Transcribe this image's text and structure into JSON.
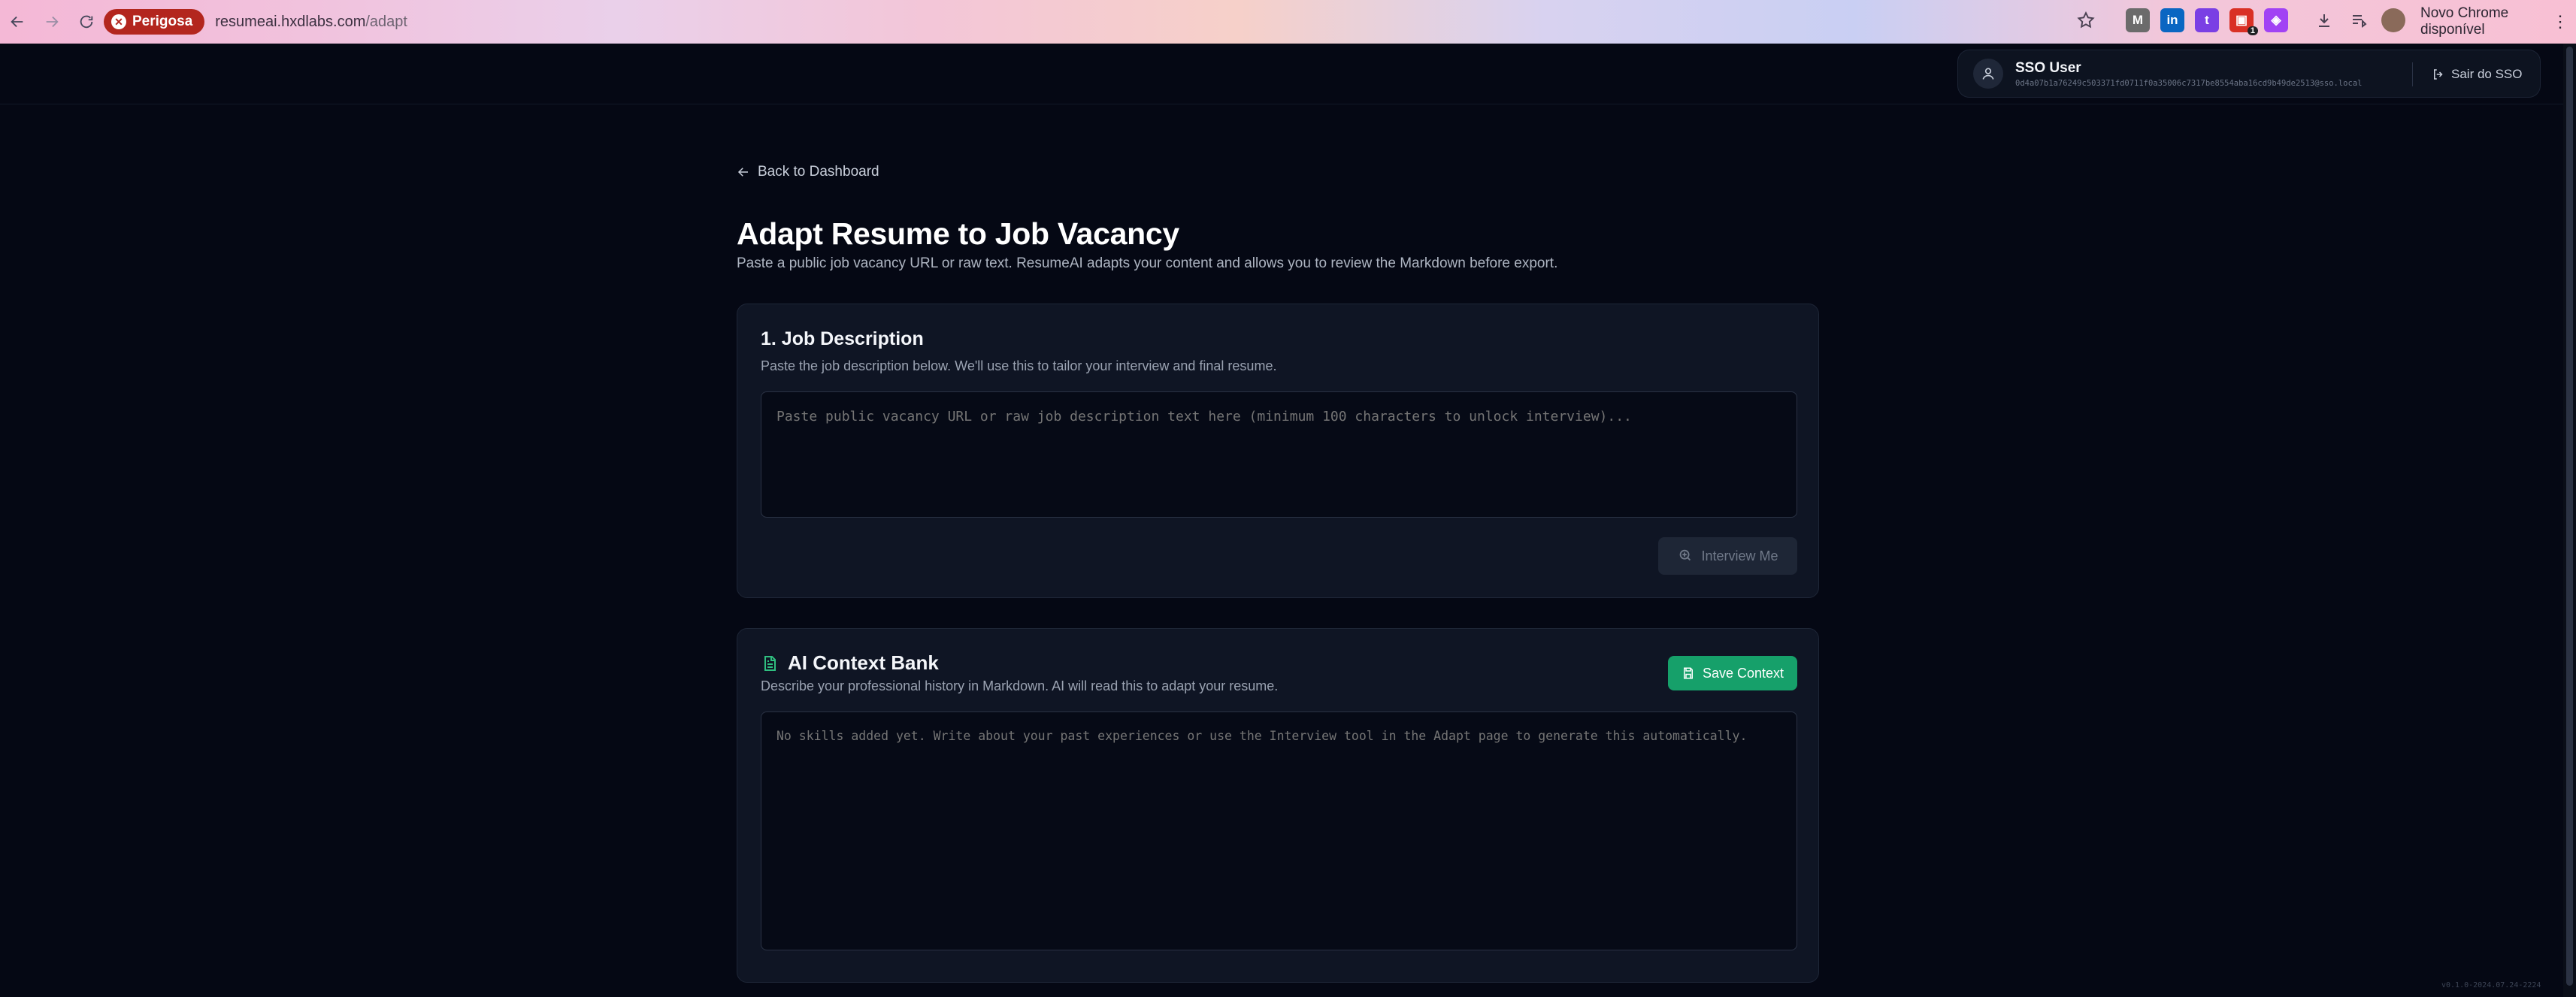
{
  "browser": {
    "security_label": "Perigosa",
    "url_host": "resumeai.hxdlabs.com",
    "url_path": "/adapt",
    "update_label": "Novo Chrome disponível",
    "extensions": [
      {
        "name": "m-extension-icon",
        "glyph": "M",
        "color": "#6b6b6b"
      },
      {
        "name": "linkedin-extension-icon",
        "glyph": "in",
        "color": "#0a66c2"
      },
      {
        "name": "twitch-extension-icon",
        "glyph": "t",
        "color": "#7a3fe4"
      },
      {
        "name": "red-extension-icon",
        "glyph": "▣",
        "color": "#d93025",
        "badge": "1"
      },
      {
        "name": "puzzle-extension-icon",
        "glyph": "◈",
        "color": "#a142f4"
      }
    ]
  },
  "header": {
    "user_name": "SSO User",
    "user_email": "0d4a07b1a76249c503371fd0711f0a35006c7317be8554aba16cd9b49de2513@sso.local",
    "logout_label": "Sair do SSO"
  },
  "page": {
    "back_label": "Back to Dashboard",
    "title": "Adapt Resume to Job Vacancy",
    "subtitle": "Paste a public job vacancy URL or raw text. ResumeAI adapts your content and allows you to review the Markdown before export."
  },
  "job_card": {
    "title": "1. Job Description",
    "description": "Paste the job description below. We'll use this to tailor your interview and final resume.",
    "placeholder": "Paste public vacancy URL or raw job description text here (minimum 100 characters to unlock interview)...",
    "interview_label": "Interview Me"
  },
  "context_card": {
    "title": "AI Context Bank",
    "description": "Describe your professional history in Markdown. AI will read this to adapt your resume.",
    "save_label": "Save Context",
    "placeholder": "No skills added yet. Write about your past experiences or use the Interview tool in the Adapt page to generate this automatically."
  },
  "footer": {
    "version": "v0.1.0-2024.07.24-2224"
  },
  "colors": {
    "background": "#050814",
    "card": "#0f1524",
    "accent_green": "#16a06a",
    "danger": "#b3261e"
  }
}
